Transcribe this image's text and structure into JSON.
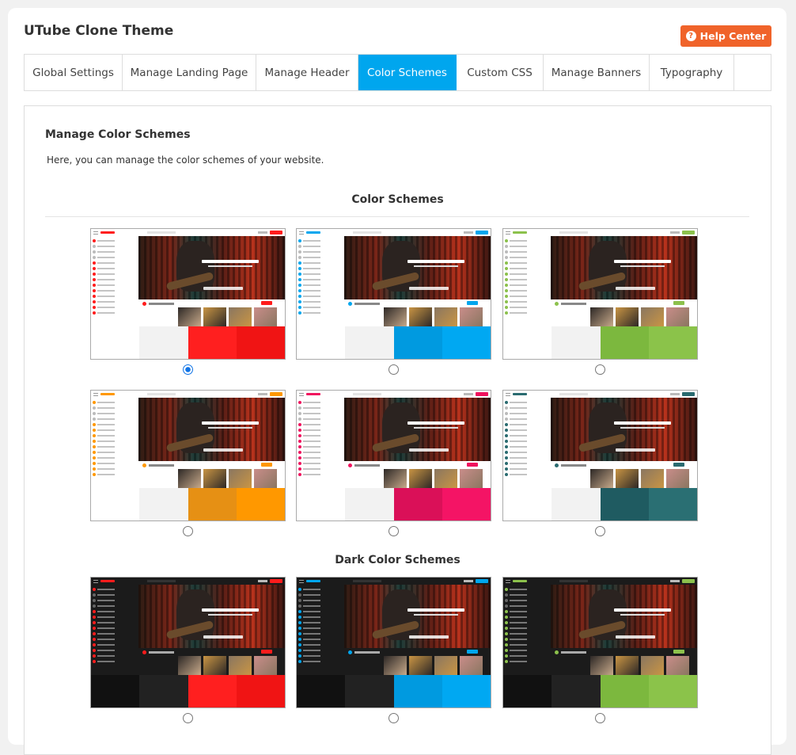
{
  "app": {
    "title": "UTube Clone Theme"
  },
  "help_button": {
    "label": "Help Center",
    "icon": "question-circle-icon"
  },
  "tabs": [
    {
      "label": "Global Settings",
      "active": false
    },
    {
      "label": "Manage Landing Page",
      "active": false
    },
    {
      "label": "Manage Header",
      "active": false
    },
    {
      "label": "Color Schemes",
      "active": true
    },
    {
      "label": "Custom CSS",
      "active": false
    },
    {
      "label": "Manage Banners",
      "active": false
    },
    {
      "label": "Typography",
      "active": false
    }
  ],
  "section": {
    "title": "Manage Color Schemes",
    "description": "Here, you can manage the color schemes of your website."
  },
  "light_group": {
    "title": "Color Schemes",
    "schemes": [
      {
        "accent": "#ff1c1c",
        "accent_dark": "#f01414",
        "palette": [
          "#ffffff",
          "#f2f2f2",
          "#ff1f1f",
          "#f01414"
        ],
        "selected": true
      },
      {
        "accent": "#00a6ee",
        "accent_dark": "#009ae0",
        "palette": [
          "#ffffff",
          "#f2f2f2",
          "#009ae0",
          "#00a8f2"
        ],
        "selected": false
      },
      {
        "accent": "#8cc14c",
        "accent_dark": "#7cb944",
        "palette": [
          "#ffffff",
          "#f2f2f2",
          "#7cb83e",
          "#8bc34a"
        ],
        "selected": false
      },
      {
        "accent": "#ff9800",
        "accent_dark": "#e69014",
        "palette": [
          "#ffffff",
          "#f2f2f2",
          "#e69014",
          "#ff9800"
        ],
        "selected": false
      },
      {
        "accent": "#f0135e",
        "accent_dark": "#da1058",
        "palette": [
          "#ffffff",
          "#f2f2f2",
          "#da1058",
          "#f41465"
        ],
        "selected": false
      },
      {
        "accent": "#2a6b70",
        "accent_dark": "#1f5b61",
        "palette": [
          "#ffffff",
          "#f2f2f2",
          "#1f5b61",
          "#2a6f73"
        ],
        "selected": false
      }
    ]
  },
  "dark_group": {
    "title": "Dark Color Schemes",
    "schemes": [
      {
        "accent": "#ff1c1c",
        "accent_dark": "#f01414",
        "palette": [
          "#111111",
          "#222222",
          "#ff1f1f",
          "#f01414"
        ],
        "selected": false
      },
      {
        "accent": "#00a6ee",
        "accent_dark": "#009ae0",
        "palette": [
          "#111111",
          "#222222",
          "#009ae0",
          "#00a8f2"
        ],
        "selected": false
      },
      {
        "accent": "#8cc14c",
        "accent_dark": "#7cb944",
        "palette": [
          "#111111",
          "#222222",
          "#7cb83e",
          "#8bc34a"
        ],
        "selected": false
      }
    ]
  }
}
